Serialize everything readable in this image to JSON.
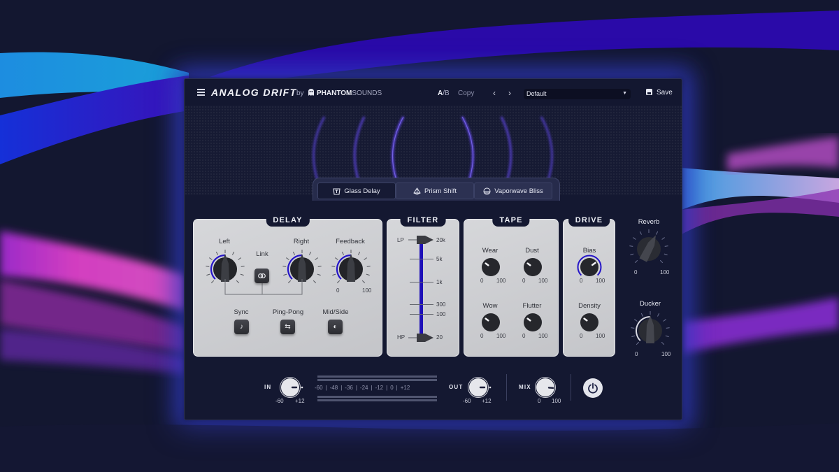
{
  "header": {
    "menu_icon": "hamburger-icon",
    "title": "ANALOG DRIFT",
    "by": "by",
    "maker_icon": "ghost-icon",
    "maker_bold": "PHANTOM",
    "maker_light": "SOUNDS",
    "ab_a": "A",
    "ab_b": "/B",
    "copy": "Copy",
    "prev_icon": "chevron-left-icon",
    "next_icon": "chevron-right-icon",
    "preset": {
      "value": "Default",
      "caret": "▼"
    },
    "save": {
      "label": "Save",
      "icon": "floppy-disk-icon"
    }
  },
  "tabs": [
    {
      "label": "Glass Delay",
      "icon": "glass-icon",
      "active": true
    },
    {
      "label": "Prism Shift",
      "icon": "prism-icon",
      "active": false
    },
    {
      "label": "Vaporwave Bliss",
      "icon": "sunset-icon",
      "active": false
    }
  ],
  "delay": {
    "title": "DELAY",
    "knobs": [
      {
        "label": "Left",
        "value": 0.5
      },
      {
        "label": "Right",
        "value": 0.5
      },
      {
        "label": "Feedback",
        "value": 0.5,
        "min": "0",
        "max": "100"
      }
    ],
    "link": {
      "label": "Link",
      "icon": "link-icon"
    },
    "buttons": [
      {
        "label": "Sync",
        "icon": "music-note-icon",
        "glyph": "♪"
      },
      {
        "label": "Ping-Pong",
        "icon": "swap-arrows-icon",
        "glyph": "⇆"
      },
      {
        "label": "Mid/Side",
        "icon": "mid-side-icon",
        "glyph": "◐"
      }
    ]
  },
  "filter": {
    "title": "FILTER",
    "lp_label": "LP",
    "hp_label": "HP",
    "lp_value": "20k",
    "hp_value": "20",
    "ticks": [
      "20k",
      "5k",
      "1k",
      "300",
      "100",
      "20"
    ]
  },
  "tape": {
    "title": "TAPE",
    "knobs": [
      {
        "label": "Wear",
        "value": 0.3,
        "min": "0",
        "max": "100"
      },
      {
        "label": "Dust",
        "value": 0.3,
        "min": "0",
        "max": "100"
      },
      {
        "label": "Wow",
        "value": 0.3,
        "min": "0",
        "max": "100"
      },
      {
        "label": "Flutter",
        "value": 0.3,
        "min": "0",
        "max": "100"
      }
    ]
  },
  "drive": {
    "title": "DRIVE",
    "knobs": [
      {
        "label": "Bias",
        "value": 0.7,
        "min": "0",
        "max": "100"
      },
      {
        "label": "Density",
        "value": 0.3,
        "min": "0",
        "max": "100"
      }
    ]
  },
  "side": {
    "reverb": {
      "label": "Reverb",
      "value": 0.6,
      "min": "0",
      "max": "100"
    },
    "ducker": {
      "label": "Ducker",
      "value": 0.5,
      "min": "0",
      "max": "100"
    }
  },
  "footer": {
    "in": {
      "label": "IN",
      "min": "-60",
      "max": "+12",
      "value": 0.75
    },
    "meter_scale": [
      "-60",
      "|",
      "-48",
      "|",
      "-36",
      "|",
      "-24",
      "|",
      "-12",
      "|",
      "0",
      "|",
      "+12"
    ],
    "out": {
      "label": "OUT",
      "min": "-60",
      "max": "+12",
      "value": 0.75
    },
    "mix": {
      "label": "MIX",
      "min": "0",
      "max": "100",
      "value": 0.85
    },
    "power_icon": "power-icon"
  },
  "colors": {
    "accent": "#2414c8",
    "panel": "#cfd0d3",
    "window": "#141831",
    "glow": "#3a45d0"
  }
}
